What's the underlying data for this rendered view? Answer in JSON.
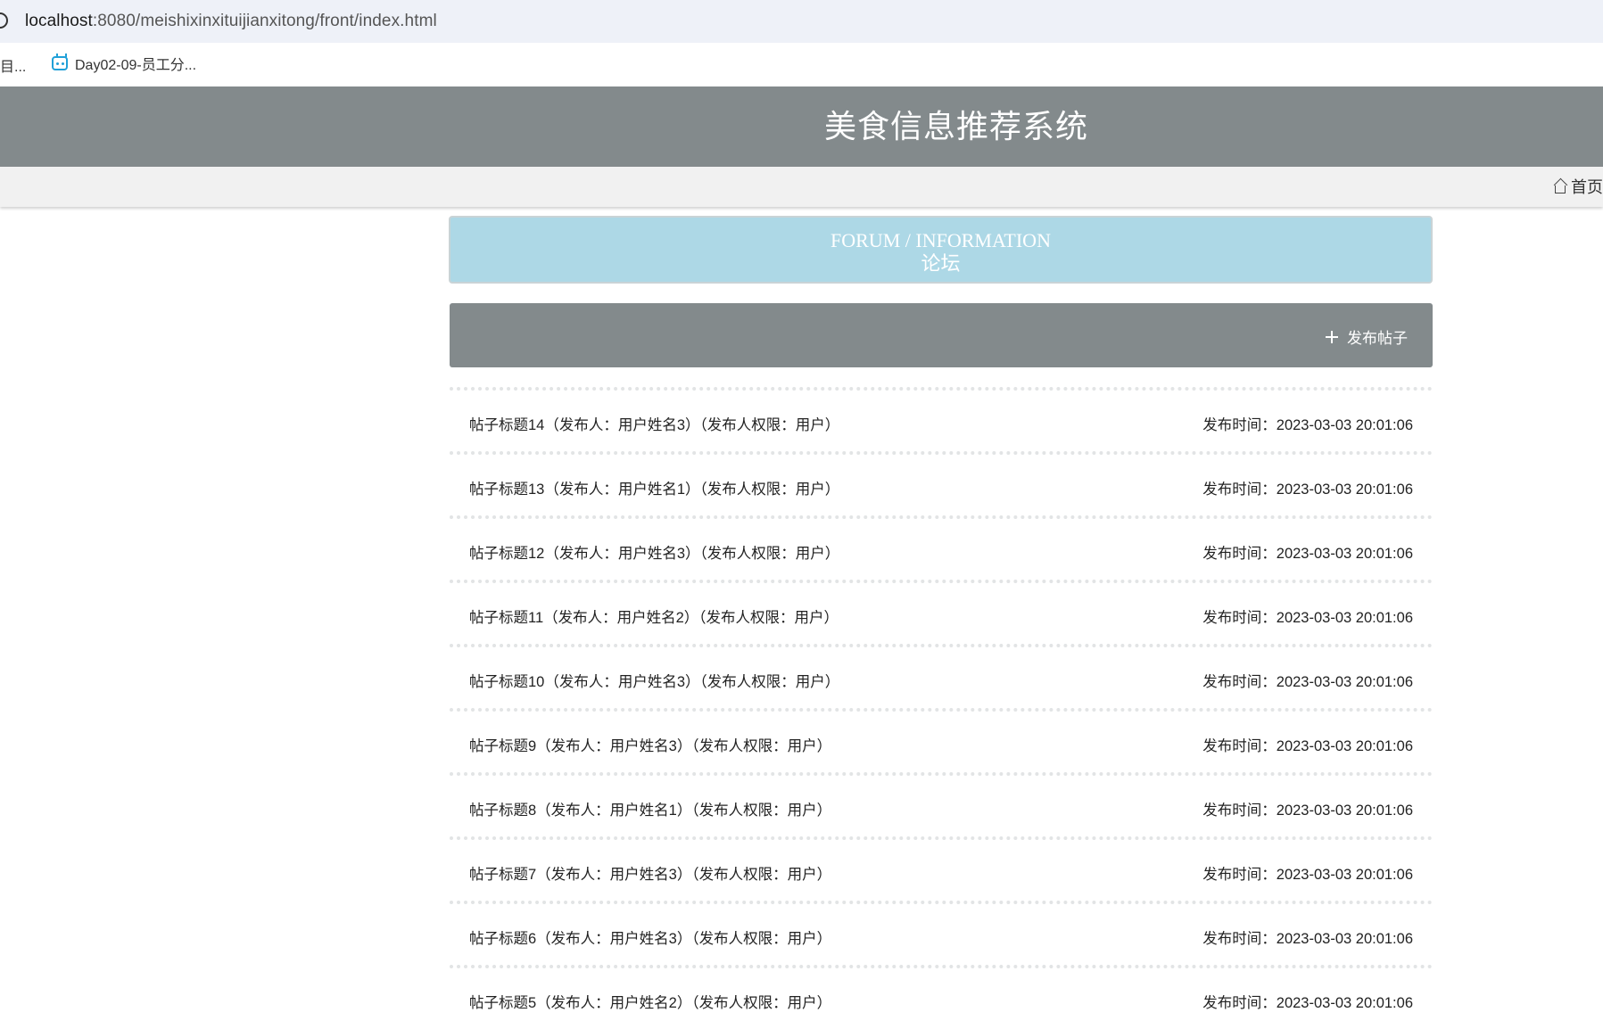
{
  "browser": {
    "url_host": "localhost",
    "url_rest": ":8080/meishixinxituijianxitong/front/index.html",
    "bookmarks": {
      "truncated_item": "目...",
      "item_label": "Day02-09-员工分..."
    }
  },
  "site": {
    "title": "美食信息推荐系统",
    "nav": {
      "home_label": "首页"
    }
  },
  "forum": {
    "banner_en": "FORUM / INFORMATION",
    "banner_cn": "论坛",
    "publish_label": "发布帖子",
    "posts": [
      {
        "title": "帖子标题14（发布人：用户姓名3）（发布人权限：用户）",
        "time": "发布时间：2023-03-03 20:01:06"
      },
      {
        "title": "帖子标题13（发布人：用户姓名1）（发布人权限：用户）",
        "time": "发布时间：2023-03-03 20:01:06"
      },
      {
        "title": "帖子标题12（发布人：用户姓名3）（发布人权限：用户）",
        "time": "发布时间：2023-03-03 20:01:06"
      },
      {
        "title": "帖子标题11（发布人：用户姓名2）（发布人权限：用户）",
        "time": "发布时间：2023-03-03 20:01:06"
      },
      {
        "title": "帖子标题10（发布人：用户姓名3）（发布人权限：用户）",
        "time": "发布时间：2023-03-03 20:01:06"
      },
      {
        "title": "帖子标题9（发布人：用户姓名3）（发布人权限：用户）",
        "time": "发布时间：2023-03-03 20:01:06"
      },
      {
        "title": "帖子标题8（发布人：用户姓名1）（发布人权限：用户）",
        "time": "发布时间：2023-03-03 20:01:06"
      },
      {
        "title": "帖子标题7（发布人：用户姓名3）（发布人权限：用户）",
        "time": "发布时间：2023-03-03 20:01:06"
      },
      {
        "title": "帖子标题6（发布人：用户姓名3）（发布人权限：用户）",
        "time": "发布时间：2023-03-03 20:01:06"
      },
      {
        "title": "帖子标题5（发布人：用户姓名2）（发布人权限：用户）",
        "time": "发布时间：2023-03-03 20:01:06"
      }
    ]
  }
}
